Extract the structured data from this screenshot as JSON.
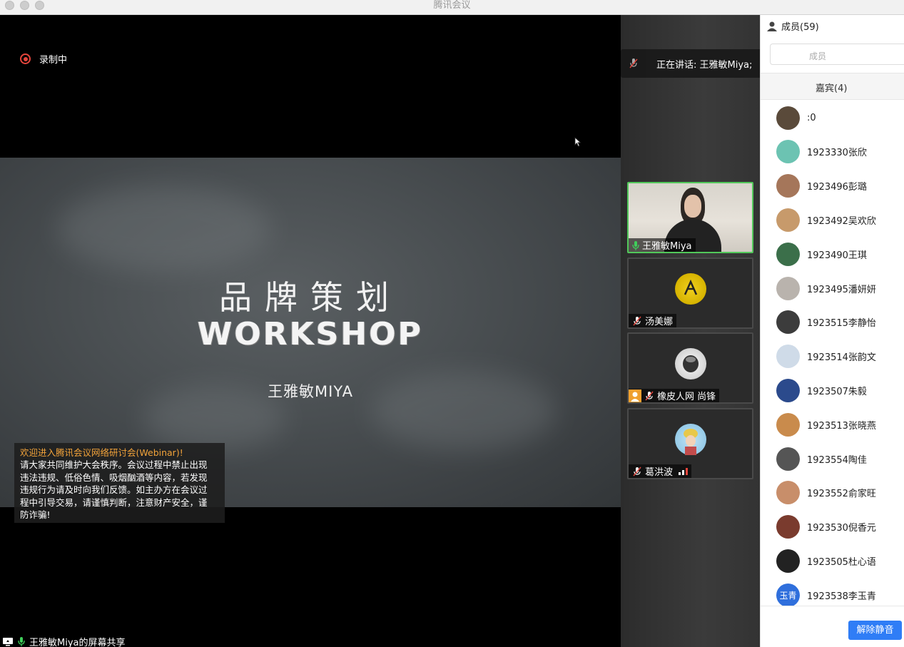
{
  "window": {
    "title": "腾讯会议"
  },
  "stage": {
    "recording_label": "录制中",
    "slide": {
      "title_cn": "品牌策划",
      "title_en": "WORKSHOP",
      "author": "王雅敏MIYA"
    },
    "notice": {
      "headline": "欢迎进入腾讯会议网络研讨会(Webinar)!",
      "lines": [
        "请大家共同维护大会秩序。会议过程中禁止出现",
        "违法违规、低俗色情、吸烟酗酒等内容，若发现",
        "违规行为请及时向我们反馈。如主办方在会议过",
        "程中引导交易，请谨慎判断，注意财产安全，谨",
        "防诈骗!"
      ]
    },
    "share_label": "王雅敏Miya的屏幕共享"
  },
  "speaking": {
    "text": "正在讲话: 王雅敏Miya;"
  },
  "video_tiles": [
    {
      "name": "王雅敏Miya",
      "mic": "on",
      "active": true
    },
    {
      "name": "汤美娜",
      "mic": "muted",
      "active": false
    },
    {
      "name": "橡皮人网 尚锋",
      "mic": "muted",
      "active": false
    },
    {
      "name": "葛洪波",
      "mic": "muted",
      "active": false
    }
  ],
  "panel": {
    "header": "成员(59)",
    "search_placeholder": "成员",
    "tab": "嘉宾(4)",
    "members": [
      {
        "name": ":0",
        "color": "#5a4a3a"
      },
      {
        "name": "1923330张欣",
        "color": "#6cc3b2"
      },
      {
        "name": "1923496彭璐",
        "color": "#a5765a"
      },
      {
        "name": "1923492吴欢欣",
        "color": "#c79a6b"
      },
      {
        "name": "1923490王琪",
        "color": "#3b6f4a"
      },
      {
        "name": "1923495潘妍妍",
        "color": "#b9b3ad"
      },
      {
        "name": "1923515李静怡",
        "color": "#3c3c3c"
      },
      {
        "name": "1923514张韵文",
        "color": "#cfdbe8"
      },
      {
        "name": "1923507朱毅",
        "color": "#2b4a8c"
      },
      {
        "name": "1923513张晓燕",
        "color": "#c98b4c"
      },
      {
        "name": "1923554陶佳",
        "color": "#555555"
      },
      {
        "name": "1923552俞家旺",
        "color": "#c88e6a"
      },
      {
        "name": "1923530倪香元",
        "color": "#7a3b2e"
      },
      {
        "name": "1923505杜心语",
        "color": "#222222"
      },
      {
        "name": "1923538李玉青",
        "color": "#2f6fdc",
        "initials": "玉青"
      }
    ],
    "unmute_label": "解除静音"
  }
}
